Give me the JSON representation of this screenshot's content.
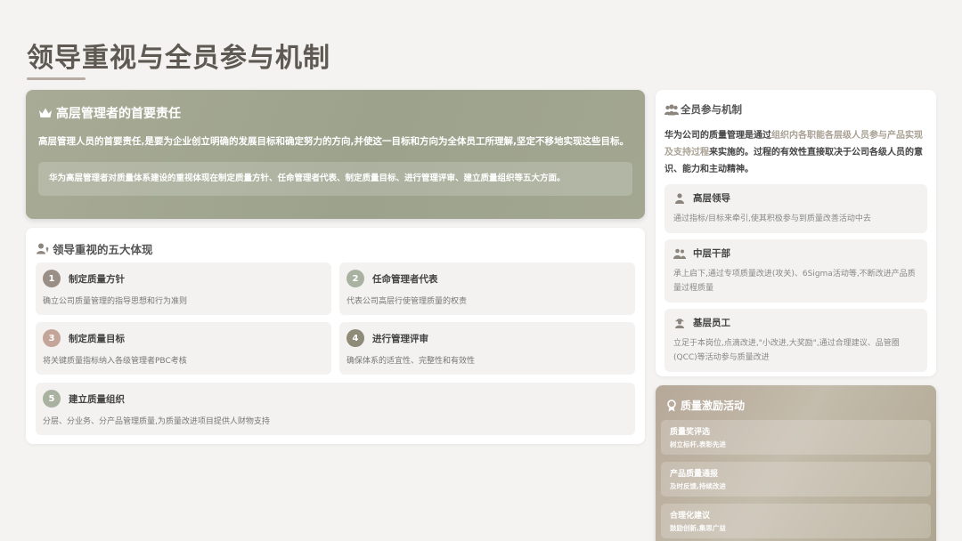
{
  "page": {
    "title": "领导重视与全员参与机制"
  },
  "hero": {
    "title": "高层管理者的首要责任",
    "desc": "高层管理人员的首要责任,是要为企业创立明确的发展目标和确定努力的方向,并使这一目标和方向为全体员工所理解,坚定不移地实现这些目标。",
    "note": "华为高层管理者对质量体系建设的重视体现在制定质量方针、任命管理者代表、制定质量目标、进行管理评审、建立质量组织等五大方面。",
    "icon": "crown-icon"
  },
  "five": {
    "title": "领导重视的五大体现",
    "items": [
      {
        "num": "1",
        "title": "制定质量方针",
        "desc": "确立公司质量管理的指导思想和行为准则",
        "color": "#9a8f86"
      },
      {
        "num": "2",
        "title": "任命管理者代表",
        "desc": "代表公司高层行使管理质量的权责",
        "color": "#a9b1a0"
      },
      {
        "num": "3",
        "title": "制定质量目标",
        "desc": "将关键质量指标纳入各级管理者PBC考核",
        "color": "#c4a59a"
      },
      {
        "num": "4",
        "title": "进行管理评审",
        "desc": "确保体系的适宜性、完整性和有效性",
        "color": "#8e8b78"
      },
      {
        "num": "5",
        "title": "建立质量组织",
        "desc": "分层、分业务、分产品管理质量,为质量改进项目提供人财物支持",
        "color": "#a9b1a0"
      }
    ]
  },
  "all": {
    "title": "全员参与机制",
    "desc_a": "华为公司的质量管理是通过",
    "desc_hl": "组织内各职能各层级人员参与产品实现及支持过程",
    "desc_b": "来实施的。过程的有效性直接取决于公司各级人员的意识、能力和主动精神。",
    "levels": [
      {
        "title": "高层领导",
        "desc": "通过指标/目标来牵引,使其积极参与到质量改善活动中去",
        "icon": "person-icon"
      },
      {
        "title": "中层干部",
        "desc": "承上启下,通过专项质量改进(攻关)、6Sigma活动等,不断改进产品质量过程质量",
        "icon": "people-icon"
      },
      {
        "title": "基层员工",
        "desc": "立足于本岗位,点滴改进,\"小改进,大奖励\",通过合理建议、品管圈(QCC)等活动参与质量改进",
        "icon": "worker-icon"
      }
    ]
  },
  "incent": {
    "title": "质量激励活动",
    "items": [
      {
        "name": "质量奖评选",
        "sub": "树立标杆,表彰先进"
      },
      {
        "name": "产品质量通报",
        "sub": "及时反馈,持续改进"
      },
      {
        "name": "合理化建议",
        "sub": "鼓励创新,集思广益"
      }
    ]
  }
}
